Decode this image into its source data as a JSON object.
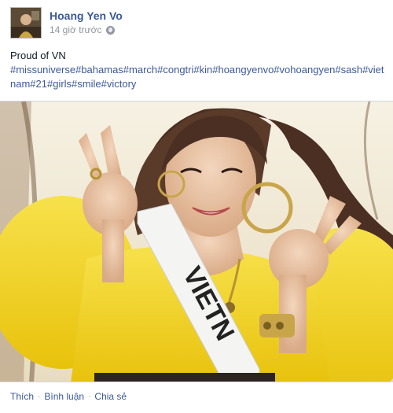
{
  "post": {
    "author": "Hoang Yen Vo",
    "timestamp": "14 giờ trước",
    "text": "Proud of VN",
    "hashtags": "#missuniverse#bahamas#march#congtri#kin#hoangyenvo#vohoangyen#sash#vietnam#21#girls#smile#victory",
    "privacy_icon": "globe-icon"
  },
  "photo": {
    "sash_text": "VIETN"
  },
  "actions": {
    "like": "Thích",
    "comment": "Bình luận",
    "share": "Chia sẻ",
    "separator": "·"
  },
  "colors": {
    "link": "#3b5998",
    "muted": "#90949c",
    "dress": "#f2d21c"
  }
}
